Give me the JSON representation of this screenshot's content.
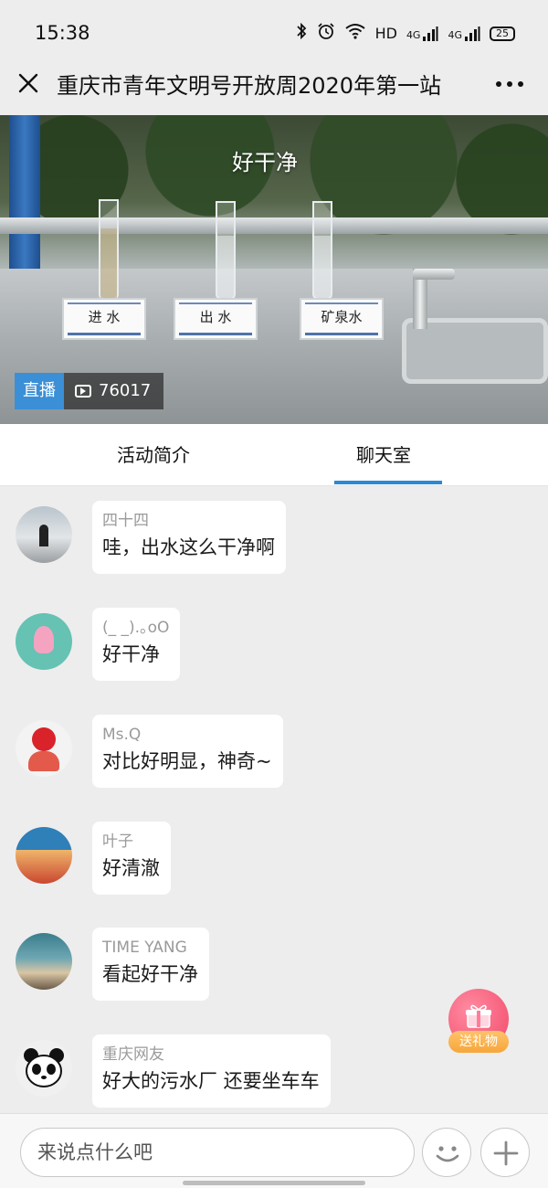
{
  "status_bar": {
    "time": "15:38",
    "network_1": "4G",
    "network_2": "4G",
    "hd": "HD",
    "battery": "25",
    "icons": [
      "bluetooth-icon",
      "alarm-icon",
      "wifi-icon",
      "signal-icon",
      "battery-icon"
    ]
  },
  "nav": {
    "title": "重庆市青年文明号开放周2020年第一站",
    "icons": [
      "close-icon",
      "more-icon"
    ]
  },
  "video": {
    "caption": "好干净",
    "labels": [
      "进 水",
      "出 水",
      "矿泉水"
    ],
    "live_label": "直播",
    "view_count": "76017"
  },
  "tabs": [
    {
      "label": "活动简介",
      "active": false
    },
    {
      "label": "聊天室",
      "active": true
    }
  ],
  "messages": [
    {
      "name": "四十四",
      "text": "哇，出水这么干净啊"
    },
    {
      "name": "(_ _).｡oO",
      "text": "好干净"
    },
    {
      "name": "Ms.Q",
      "text": "对比好明显，神奇~"
    },
    {
      "name": "叶子",
      "text": "好清澈"
    },
    {
      "name": "TIME YANG",
      "text": "看起好干净"
    },
    {
      "name": "重庆网友",
      "text": "好大的污水厂 还要坐车车"
    }
  ],
  "gift": {
    "label": "送礼物"
  },
  "input": {
    "placeholder": "来说点什么吧"
  },
  "colors": {
    "accent": "#2d88d6",
    "live_badge": "#3b8fd6",
    "gift_pink": "#f24a69",
    "gift_orange": "#f7a63a",
    "background": "#ededed"
  }
}
